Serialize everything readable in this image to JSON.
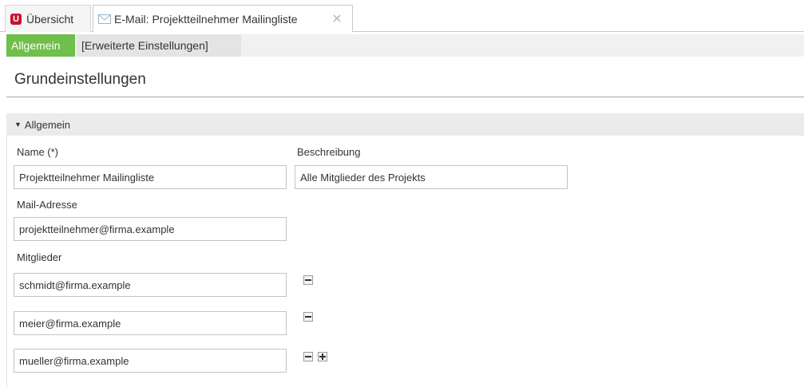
{
  "tabs": {
    "overview_label": "Übersicht",
    "mail_label": "E-Mail: Projektteilnehmer Mailingliste"
  },
  "subtabs": {
    "general": "Allgemein",
    "advanced": "[Erweiterte Einstellungen]"
  },
  "page_title": "Grundeinstellungen",
  "section": {
    "title": "Allgemein",
    "name_label": "Name (*)",
    "name_value": "Projektteilnehmer Mailingliste",
    "description_label": "Beschreibung",
    "description_value": "Alle Mitglieder des Projekts",
    "mail_label": "Mail-Adresse",
    "mail_value": "projektteilnehmer@firma.example",
    "members_label": "Mitglieder",
    "members": [
      "schmidt@firma.example",
      "meier@firma.example",
      "mueller@firma.example"
    ]
  },
  "colors": {
    "brand": "#c8102e",
    "active_subtab": "#6fbf4a"
  }
}
